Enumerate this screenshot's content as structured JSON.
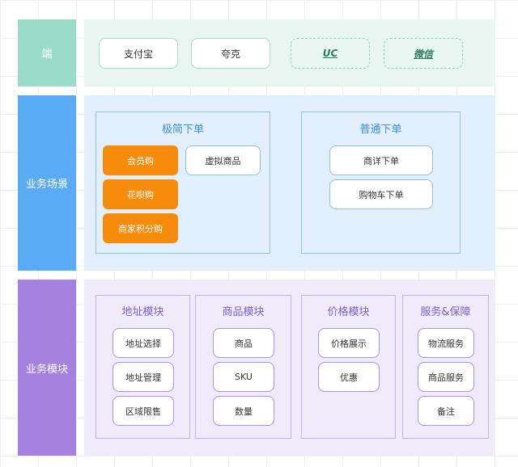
{
  "rows": {
    "terminal": {
      "label": "端",
      "label_color": "#9bdcc8",
      "panel_color": "#e8f5f0"
    },
    "scenario": {
      "label": "业务场景",
      "label_color": "#5aabf5",
      "panel_color": "#e2effd"
    },
    "module": {
      "label": "业务模块",
      "label_color": "#a483e0",
      "panel_color": "#efebfa"
    }
  },
  "terminals": {
    "alipay": "支付宝",
    "quark": "夸克",
    "uc": "UC",
    "wechat": "微信"
  },
  "scenarios": {
    "minimal_order": {
      "title": "极简下单",
      "items": [
        "会员购",
        "花呗购",
        "商家积分购",
        "虚拟商品"
      ]
    },
    "normal_order": {
      "title": "普通下单",
      "items": [
        "商详下单",
        "购物车下单"
      ]
    }
  },
  "modules": {
    "address": {
      "title": "地址模块",
      "items": [
        "地址选择",
        "地址管理",
        "区域限售"
      ]
    },
    "product": {
      "title": "商品模块",
      "items": [
        "商品",
        "SKU",
        "数量"
      ]
    },
    "price": {
      "title": "价格模块",
      "items": [
        "价格展示",
        "优惠"
      ]
    },
    "service": {
      "title": "服务&保障",
      "items": [
        "物流服务",
        "商品服务",
        "备注"
      ]
    }
  },
  "colors": {
    "orange": "#f78c0c",
    "scenario_title": "#3a8fe0",
    "module_title": "#7d5fc9"
  }
}
